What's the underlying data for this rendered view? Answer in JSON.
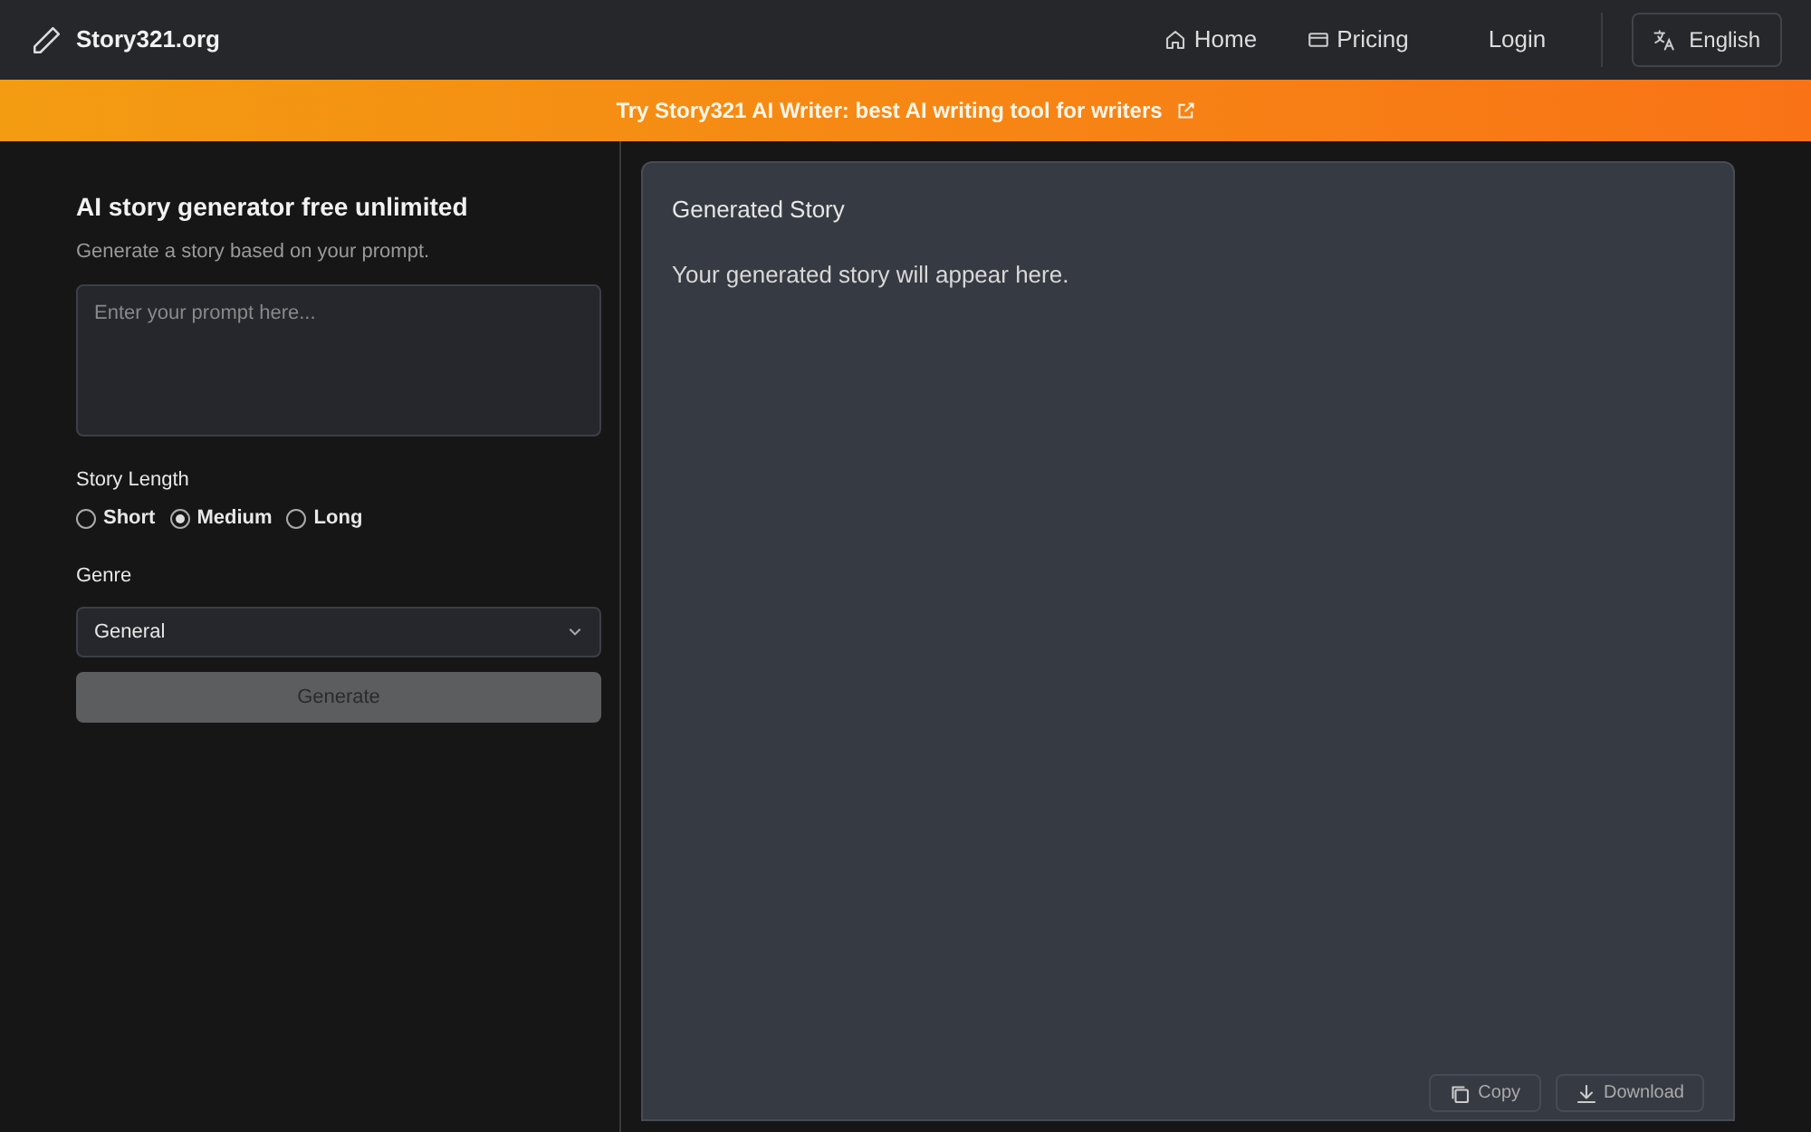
{
  "navbar": {
    "brand": "Story321.org",
    "links": [
      {
        "label": "Home"
      },
      {
        "label": "Pricing"
      }
    ],
    "login": "Login",
    "language": "English"
  },
  "banner": {
    "text": "Try Story321 AI Writer: best AI writing tool for writers"
  },
  "form": {
    "title": "AI story generator free unlimited",
    "subtitle": "Generate a story based on your prompt.",
    "prompt": {
      "placeholder": "Enter your prompt here..."
    },
    "length_label": "Story Length",
    "lengths": [
      {
        "label": "Short",
        "selected": false
      },
      {
        "label": "Medium",
        "selected": true
      },
      {
        "label": "Long",
        "selected": false
      }
    ],
    "genre_label": "Genre",
    "genre": "General",
    "generate": "Generate",
    "generate_disabled": true
  },
  "output": {
    "title": "Generated Story",
    "placeholder_text": "Your generated story will appear here.",
    "actions": [
      {
        "label": "Copy"
      },
      {
        "label": "Download"
      }
    ]
  }
}
